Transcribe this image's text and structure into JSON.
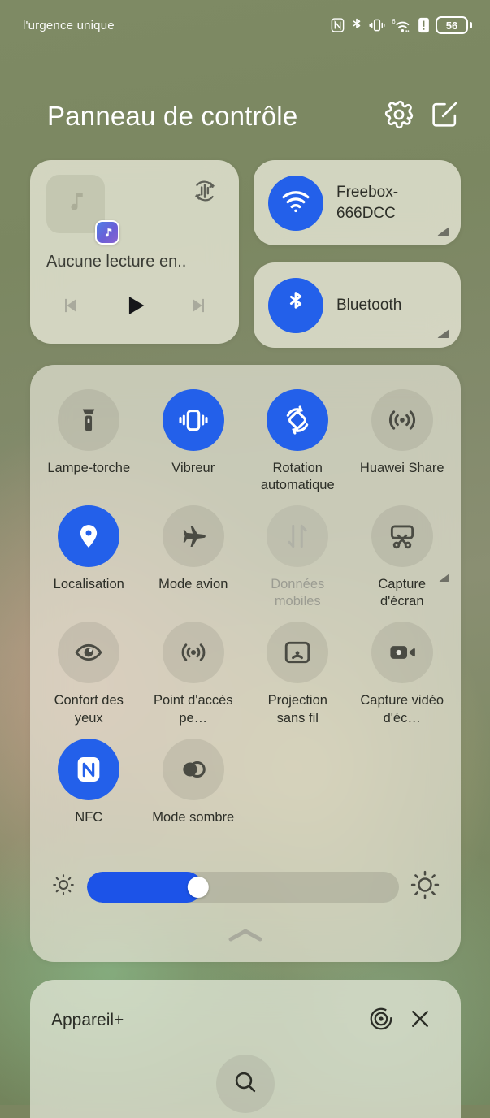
{
  "statusbar": {
    "carrier_text": "l'urgence unique",
    "battery_percent": "56",
    "icons": [
      "nfc-icon",
      "bluetooth-icon",
      "vibrate-icon",
      "wifi-6-icon",
      "warning-icon",
      "battery-icon"
    ]
  },
  "header": {
    "title": "Panneau de contrôle",
    "settings_icon": "gear-icon",
    "edit_icon": "edit-square-icon"
  },
  "media": {
    "title": "Aucune lecture en..",
    "album_icon": "music-note-icon",
    "app_badge_icon": "music-app-icon",
    "cast_icon": "audio-output-switch-icon",
    "prev_icon": "skip-previous-icon",
    "play_icon": "play-icon",
    "next_icon": "skip-next-icon"
  },
  "connectivity": [
    {
      "name": "wifi",
      "label": "Freebox-666DCC",
      "icon": "wifi-icon",
      "active": true,
      "expandable": true
    },
    {
      "name": "bluetooth",
      "label": "Bluetooth",
      "icon": "bluetooth-icon",
      "active": true,
      "expandable": true
    }
  ],
  "toggles": [
    {
      "label": "Lampe-torche",
      "icon": "flashlight-icon",
      "state": "off"
    },
    {
      "label": "Vibreur",
      "icon": "vibrate-icon",
      "state": "on"
    },
    {
      "label": "Rotation automatique",
      "icon": "auto-rotate-icon",
      "state": "on"
    },
    {
      "label": "Huawei Share",
      "icon": "huawei-share-icon",
      "state": "off"
    },
    {
      "label": "Localisation",
      "icon": "location-pin-icon",
      "state": "on"
    },
    {
      "label": "Mode avion",
      "icon": "airplane-icon",
      "state": "off"
    },
    {
      "label": "Données mobiles",
      "icon": "mobile-data-icon",
      "state": "disabled"
    },
    {
      "label": "Capture d'écran",
      "icon": "screenshot-icon",
      "state": "off",
      "expandable": true
    },
    {
      "label": "Confort des yeux",
      "icon": "eye-comfort-icon",
      "state": "off"
    },
    {
      "label": "Point d'accès pe…",
      "icon": "hotspot-icon",
      "state": "off"
    },
    {
      "label": "Projection sans fil",
      "icon": "wireless-cast-icon",
      "state": "off"
    },
    {
      "label": "Capture vidéo d'éc…",
      "icon": "screen-record-icon",
      "state": "off"
    },
    {
      "label": "NFC",
      "icon": "nfc-icon",
      "state": "on"
    },
    {
      "label": "Mode sombre",
      "icon": "dark-mode-icon",
      "state": "off"
    }
  ],
  "brightness": {
    "value_percent": 37,
    "low_icon": "brightness-low-icon",
    "high_icon": "brightness-high-icon",
    "collapse_icon": "chevron-up-icon"
  },
  "device_panel": {
    "title": "Appareil+",
    "scan_icon": "radar-target-icon",
    "close_icon": "close-icon",
    "search_icon": "search-icon"
  },
  "colors": {
    "accent_blue": "#2360ea",
    "slider_blue": "#1c53e8",
    "panel_bg": "#e9e8da",
    "text_dark": "#2c2e27",
    "text_disabled": "#9b9c92"
  }
}
